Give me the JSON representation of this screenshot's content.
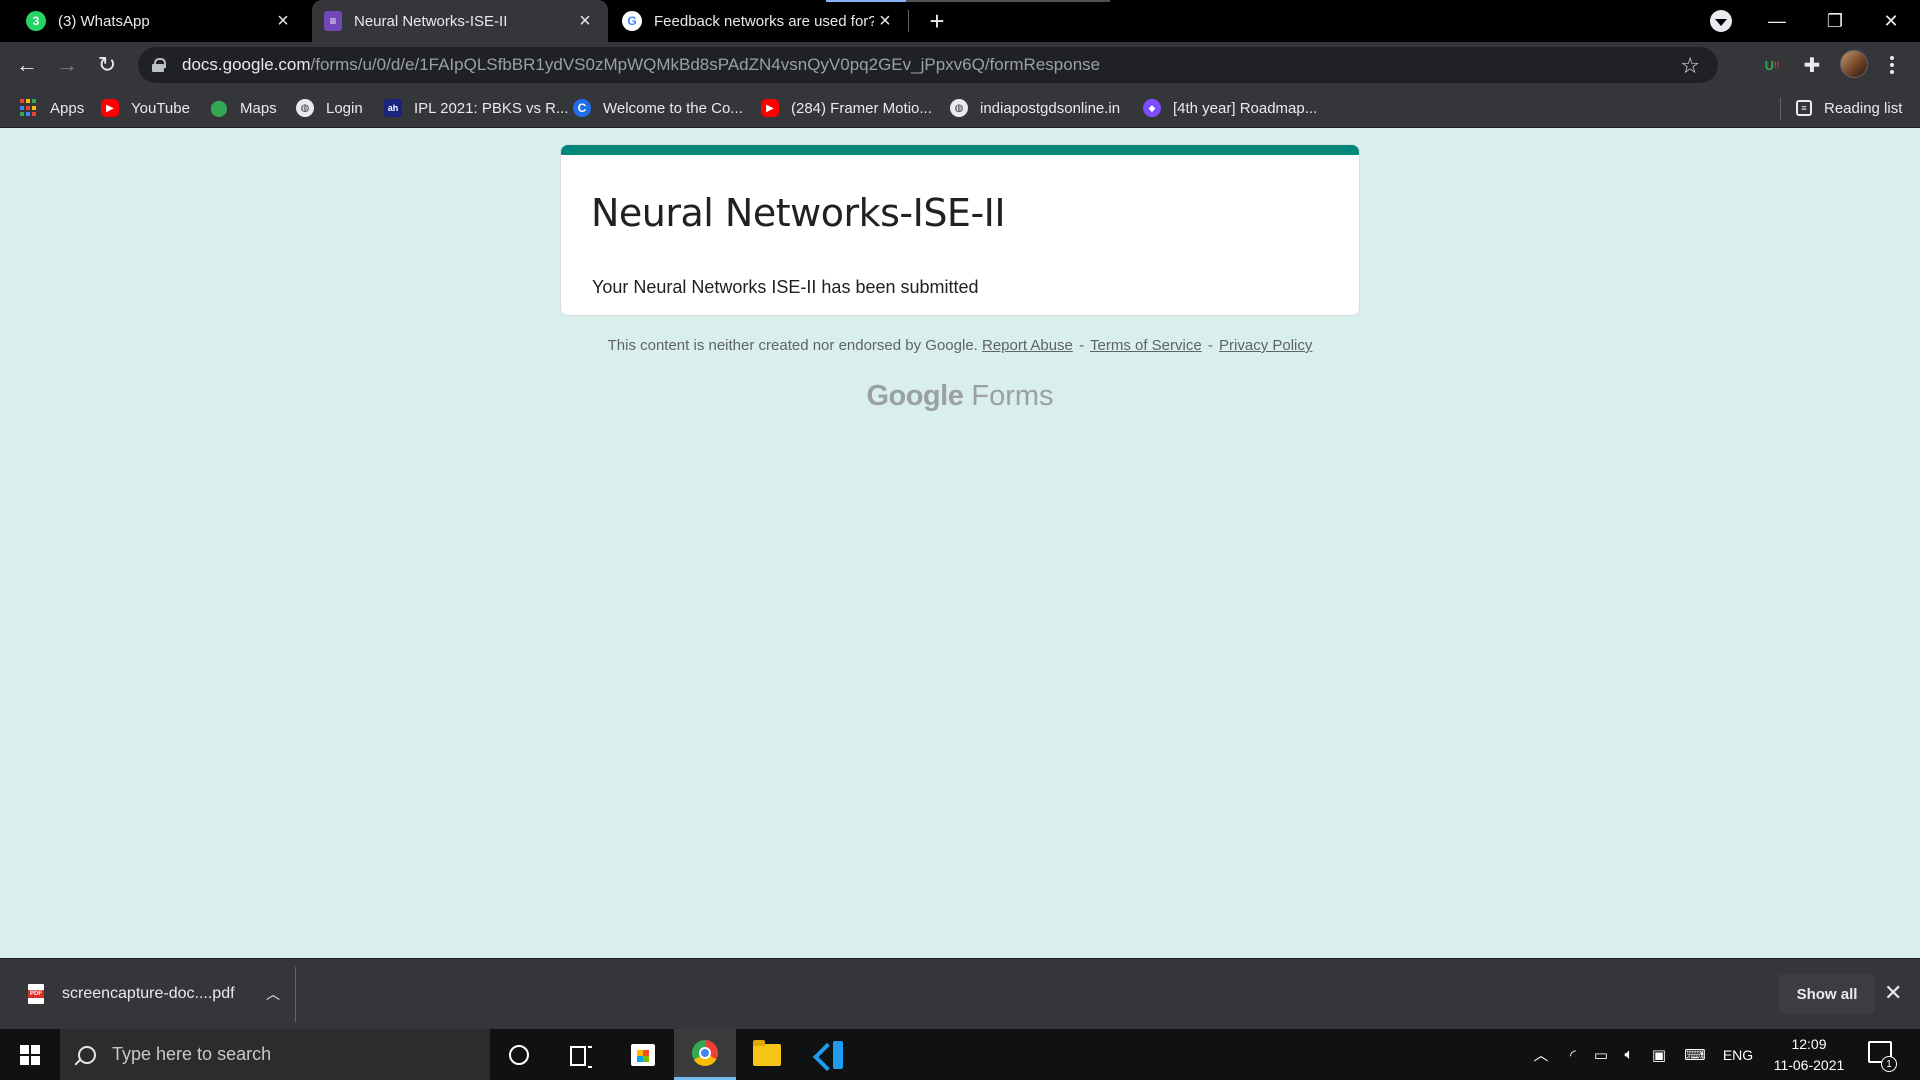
{
  "browser": {
    "tabs": [
      {
        "title": "(3) WhatsApp",
        "icon": "whatsapp-icon",
        "icon_color": "#25d366",
        "badge": "3",
        "active": false
      },
      {
        "title": "Neural Networks-ISE-II",
        "icon": "google-forms-icon",
        "icon_color": "#7248b9",
        "active": true
      },
      {
        "title": "Feedback networks are used for?",
        "icon": "google-icon",
        "icon_color": "#4285f4",
        "active": false
      }
    ],
    "address": {
      "host": "docs.google.com",
      "path": "/forms/u/0/d/e/1FAIpQLSfbBR1ydVS0zMpWQMkBd8sPAdZN4vsnQyV0pq2GEv_jPpxv6Q/formResponse"
    },
    "bookmarks": [
      {
        "label": "Apps",
        "icon": "apps-grid-icon"
      },
      {
        "label": "YouTube",
        "icon": "youtube-icon",
        "color": "#ff0000"
      },
      {
        "label": "Maps",
        "icon": "maps-pin-icon",
        "color": "#34a853"
      },
      {
        "label": "Login",
        "icon": "globe-icon",
        "color": "#e8eaed"
      },
      {
        "label": "IPL 2021: PBKS vs R...",
        "icon": "news-icon",
        "color": "#1a237e"
      },
      {
        "label": "Welcome to the Co...",
        "icon": "coursera-c-icon",
        "color": "#1f6feb"
      },
      {
        "label": "(284) Framer Motio...",
        "icon": "youtube-icon",
        "color": "#ff0000"
      },
      {
        "label": "indiapostgdsonline.in",
        "icon": "globe-icon",
        "color": "#e8eaed"
      },
      {
        "label": "[4th year] Roadmap...",
        "icon": "notion-diamond-icon",
        "color": "#7c4dff"
      }
    ],
    "reading_list": "Reading list"
  },
  "form": {
    "title": "Neural Networks-ISE-II",
    "message": "Your Neural Networks ISE-II has been submitted",
    "accent_color": "#00897b",
    "disclaimer": "This content is neither created nor endorsed by Google.",
    "links": {
      "report_abuse": "Report Abuse",
      "terms": "Terms of Service",
      "privacy": "Privacy Policy"
    },
    "separator": "-",
    "brand_google": "Google",
    "brand_forms": "Forms"
  },
  "downloads": {
    "file_name": "screencapture-doc....pdf",
    "show_all": "Show all"
  },
  "taskbar": {
    "search_placeholder": "Type here to search",
    "language": "ENG",
    "time": "12:09",
    "date": "11-06-2021",
    "notification_count": "1"
  }
}
